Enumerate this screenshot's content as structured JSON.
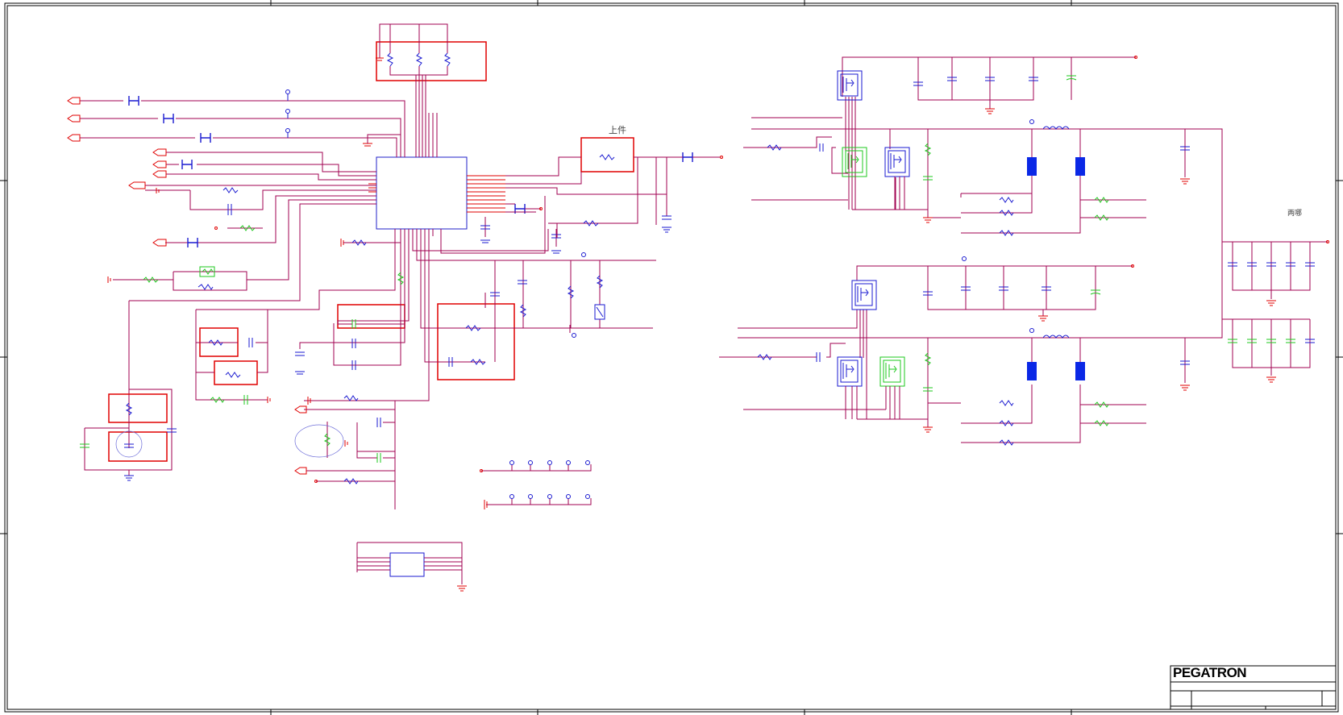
{
  "labels": {
    "top_center": "上件",
    "right": "两哪"
  },
  "title_block": {
    "company": "PEGATRON"
  },
  "colors": {
    "wire": "#a00050",
    "net": "#8a0a8a",
    "part": "#1a1ad0",
    "highlight": "#e00000",
    "alt_part": "#1ec81e",
    "frame": "#000000"
  }
}
